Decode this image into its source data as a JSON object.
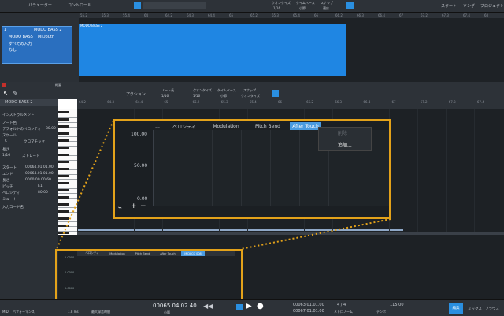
{
  "top_toolbar": {
    "param_label": "パラメーター",
    "control_label": "コントロール",
    "quantize_label": "クオンタイズ",
    "quantize_value": "1/16",
    "timebase_label": "タイムベース",
    "timebase_value": "小節",
    "snap_label": "スナップ",
    "snap_value": "適応",
    "start_label": "スタート",
    "song_label": "ソング",
    "project_label": "プロジェクト"
  },
  "track": {
    "name": "MODO BASS 2",
    "number": "1",
    "input": "MODO BASS",
    "midi_device": "MiDputh",
    "all_inputs": "すべての入力",
    "none": "なし",
    "clip_name": "MODO BASS 2"
  },
  "top_ruler": [
    "55.2",
    "55.3",
    "55.4",
    "64",
    "64.2",
    "64.3",
    "64.4",
    "65",
    "65.2",
    "65.3",
    "65.4",
    "66",
    "66.2",
    "66.3",
    "66.4",
    "67",
    "67.2",
    "67.3",
    "67.4",
    "68"
  ],
  "top_status": "概要",
  "editor_toolbar": {
    "action_label": "アクション",
    "note_length_label": "ノート長",
    "note_length_value": "1/16",
    "quantize_label": "クオンタイズ",
    "quantize_value": "1/16",
    "timebase_label": "タイムベース",
    "timebase_value": "小節",
    "snap_label": "スナップ",
    "snap_value": "クオンタイズ"
  },
  "inspector": {
    "header": "MODO BASS 2",
    "instrument_label": "インストゥルメント",
    "note_color_label": "ノート色",
    "velocity_label": "デフォルトのベロシティ",
    "velocity_value": "80.00",
    "scale_label": "スケール",
    "scale_key": "C",
    "scale_type": "クロマチック",
    "length_label": "長さ",
    "length_value": "1/16",
    "length_mode": "ストレート",
    "start_label": "スタート",
    "start_value": "00064.01.01.00",
    "end_label": "エンド",
    "end_value": "00064.01.01.00",
    "length2_label": "長さ",
    "length2_value": "0000.00.00.60",
    "pitch_label": "ピッチ",
    "pitch_value": "E1",
    "vel2_label": "ベロシティ",
    "vel2_value": "80.00",
    "mute_label": "ミュート",
    "name_label": "入力コード名"
  },
  "editor_ruler": [
    "64.2",
    "64.3",
    "64.4",
    "65",
    "65.2",
    "65.3",
    "65.4",
    "66",
    "66.2",
    "66.3",
    "66.4",
    "67",
    "67.2",
    "67.3",
    "67.4"
  ],
  "zoom": {
    "tabs": [
      "...",
      "ベロシティ",
      "Modulation",
      "Pitch Bend",
      "After Touch"
    ],
    "y_labels": [
      "100.00",
      "50.00",
      "0.00"
    ],
    "menu_disabled": "削除",
    "menu_add": "追加..."
  },
  "small_lane": {
    "tabs": [
      "ベロシティ",
      "Modulation",
      "Pitch Bend",
      "After Touch",
      "MIDI CC 008"
    ],
    "y_labels": [
      "1.0000",
      "0.0000",
      "0.0000"
    ]
  },
  "transport": {
    "midi_label": "MIDI",
    "perf_label": "パフォーマンス",
    "latency": "1.8 ms",
    "rec_label": "最大録音時間",
    "time": "00065.04.02.40",
    "unit": "小節",
    "loop_l": "00063.01.01.00",
    "loop_r": "00067.01.01.00",
    "meter": "4 / 4",
    "metronome": "メトロノーム",
    "tempo": "115.00",
    "tempo_label": "テンポ",
    "tab_edit": "編集",
    "tab_mix": "ミックス",
    "tab_browse": "ブラウズ"
  }
}
